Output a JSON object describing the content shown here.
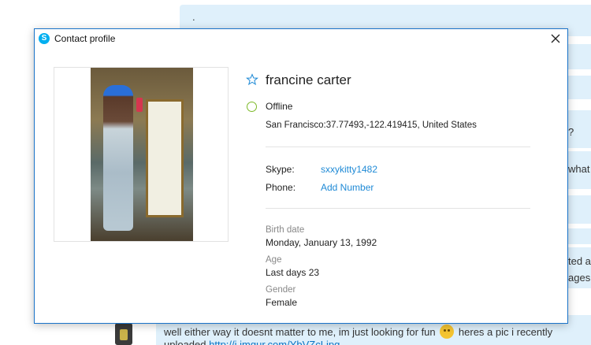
{
  "background_chat": {
    "dot": ".",
    "fragments": {
      "f1": "?",
      "f2": "what",
      "f3": "ted al",
      "f4": "ages"
    },
    "last_message": {
      "line1_before": "well either way it doesnt matter to me, im just looking for fun",
      "line1_after": "heres a pic i recently",
      "line2_before": "uploaded",
      "line2_link": "http://i.imgur.com/YbVZcLjpg"
    }
  },
  "dialog": {
    "title": "Contact profile",
    "contact": {
      "name": "francine carter",
      "status": "Offline",
      "location": "San Francisco:37.77493,-122.419415, United States"
    },
    "fields": {
      "skype_label": "Skype:",
      "skype_value": "sxxykitty1482",
      "phone_label": "Phone:",
      "phone_value": "Add Number"
    },
    "details": {
      "birth_label": "Birth date",
      "birth_value": "Monday, January 13, 1992",
      "age_label": "Age",
      "age_value": "Last days 23",
      "gender_label": "Gender",
      "gender_value": "Female"
    }
  },
  "colors": {
    "accent": "#1f8ad6",
    "border": "#1a73c9",
    "status_offline": "#7cb927",
    "chat_bubble": "#dff0fb"
  },
  "icons": [
    "skype-icon",
    "close-icon",
    "star-icon",
    "status-offline-icon",
    "smiley-icon"
  ]
}
